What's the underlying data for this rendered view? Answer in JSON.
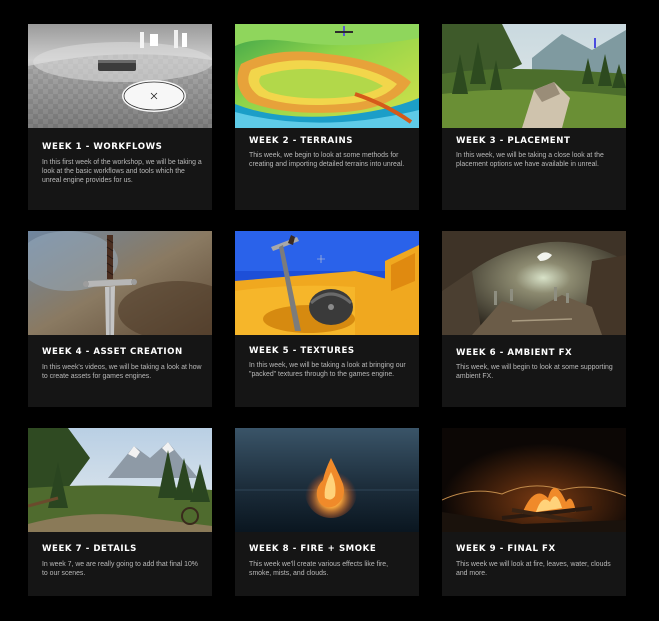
{
  "weeks": [
    {
      "title": "WEEK 1 - WORKFLOWS",
      "description": "In this first week of the workshop, we will be taking a look at the basic workflows and tools which the unreal engine provides for us.",
      "thumbnail": "editor-viewport-thumbnail"
    },
    {
      "title": "WEEK 2 - TERRAINS",
      "description": "This week, we begin to look at some methods for creating and importing detailed terrains into unreal.",
      "thumbnail": "terrain-heightmap-thumbnail"
    },
    {
      "title": "WEEK 3 - PLACEMENT",
      "description": "In this week, we will be taking a close look at the placement options we have available in unreal.",
      "thumbnail": "forest-valley-thumbnail"
    },
    {
      "title": "WEEK 4 - ASSET CREATION",
      "description": "In this week's videos, we will be taking a look at how to create assets for games engines.",
      "thumbnail": "sword-thumbnail"
    },
    {
      "title": "WEEK 5 - TEXTURES",
      "description": "In this week, we will be taking a look at bringing our \"packed\" textures through to the games engine.",
      "thumbnail": "sword-and-helmet-thumbnail"
    },
    {
      "title": "WEEK 6 - AMBIENT FX",
      "description": "This week, we will begin to look at some supporting ambient FX.",
      "thumbnail": "cave-thumbnail"
    },
    {
      "title": "WEEK 7 - DETAILS",
      "description": "In week 7, we are really going to add that final 10% to our scenes.",
      "thumbnail": "mountain-forest-thumbnail"
    },
    {
      "title": "WEEK 8 - FIRE + SMOKE",
      "description": "This week we'll create various effects like fire, smoke, mists, and clouds.",
      "thumbnail": "fire-smoke-thumbnail"
    },
    {
      "title": "WEEK 9 - FINAL FX",
      "description": "This week we will look at fire, leaves, water, clouds and more.",
      "thumbnail": "campfire-thumbnail"
    }
  ]
}
